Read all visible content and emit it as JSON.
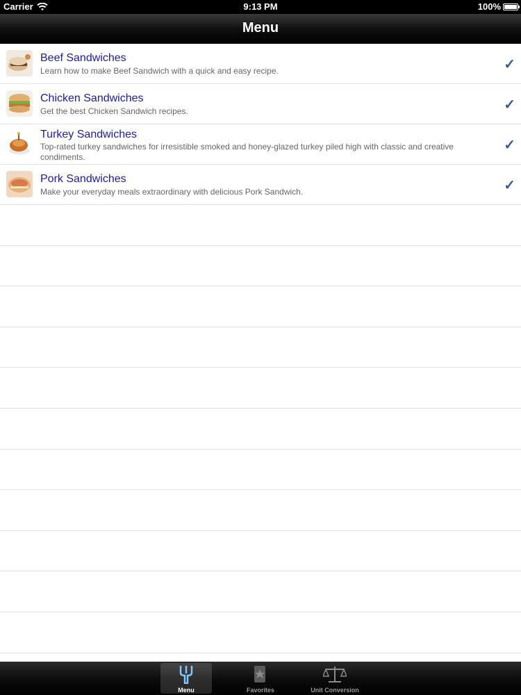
{
  "status_bar": {
    "carrier": "Carrier",
    "time": "9:13 PM",
    "battery": "100%"
  },
  "nav": {
    "title": "Menu"
  },
  "colors": {
    "title": "#1a1ab0",
    "check": "#3b5998",
    "tab_active": "#7ec8ff"
  },
  "items": [
    {
      "title": "Beef Sandwiches",
      "subtitle": "Learn how to make Beef Sandwich with a quick and easy recipe.",
      "check": "✓",
      "thumb": "beef-sandwich-thumbnail"
    },
    {
      "title": "Chicken Sandwiches",
      "subtitle": "Get the best Chicken Sandwich recipes.",
      "check": "✓",
      "thumb": "chicken-sandwich-thumbnail"
    },
    {
      "title": "Turkey Sandwiches",
      "subtitle": "Top-rated turkey sandwiches for irresistible smoked and honey-glazed turkey piled high with classic and creative condiments.",
      "check": "✓",
      "thumb": "turkey-sandwich-thumbnail"
    },
    {
      "title": "Pork Sandwiches",
      "subtitle": "Make your everyday meals extraordinary with delicious Pork Sandwich.",
      "check": "✓",
      "thumb": "pork-sandwich-thumbnail"
    }
  ],
  "tabs": [
    {
      "label": "Menu",
      "icon": "fork-icon",
      "selected": true
    },
    {
      "label": "Favorites",
      "icon": "star-bookmark-icon",
      "selected": false
    },
    {
      "label": "Unit Conversion",
      "icon": "scale-icon",
      "selected": false
    }
  ]
}
